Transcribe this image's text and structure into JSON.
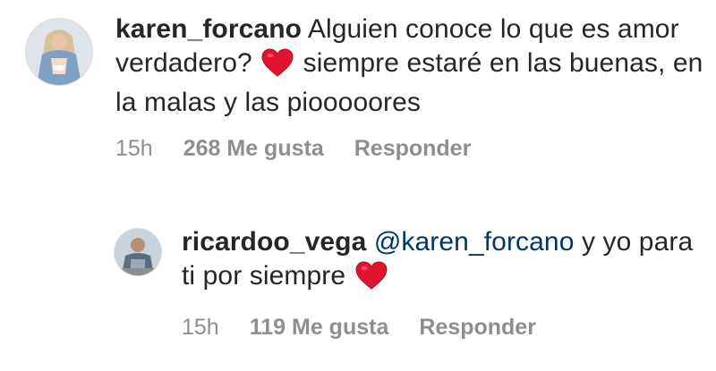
{
  "comments": [
    {
      "username": "karen_forcano",
      "text_before_heart": "Alguien conoce lo que es amor verdadero?",
      "text_after_heart": "siempre estaré en las buenas, en la malas y las piooooores",
      "time": "15h",
      "likes": "268 Me gusta",
      "reply_label": "Responder"
    },
    {
      "username": "ricardoo_vega",
      "mention": "@karen_forcano",
      "text_before_heart": "y yo para ti por siempre",
      "time": "15h",
      "likes": "119 Me gusta",
      "reply_label": "Responder"
    }
  ],
  "colors": {
    "text": "#262626",
    "meta": "#8e8e8e",
    "mention": "#00376b",
    "heart": "#e0142e"
  },
  "icons": [
    "red-heart-emoji"
  ]
}
